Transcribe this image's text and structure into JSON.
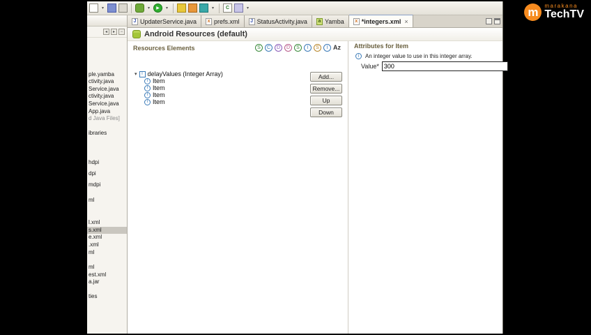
{
  "colors": {
    "brand_orange": "#f68b1f",
    "android_green": "#a4c639",
    "selection_gray": "#c9c6bf",
    "focus_border": "#222222"
  },
  "logo": {
    "m": "m",
    "brand": "marakana",
    "name": "TechTV"
  },
  "toolbar": {
    "icons": [
      {
        "name": "new-file",
        "style": "background:#fefefc;border:1px solid #8a887e"
      },
      {
        "name": "new-dropdown",
        "glyph": "▾"
      },
      {
        "name": "save",
        "style": "background:#7d8fd0;border:1px solid #4a5aa8"
      },
      {
        "name": "print",
        "style": "background:#dcd9d0;border:1px solid #8a887e"
      },
      {
        "name": "debug",
        "style": "background:#6faa3a;border:1px solid #4a7a1a;border-radius:3px"
      },
      {
        "name": "debug-dropdown",
        "glyph": "▾"
      },
      {
        "name": "run",
        "glyph": "▶",
        "style": "background:#2fae2f;color:#fff;border:1px solid #1a7a1a;border-radius:50%;font-size:6px"
      },
      {
        "name": "run-dropdown",
        "glyph": "▾"
      },
      {
        "name": "android-sdk",
        "style": "background:#e8c83a;border:1px solid #a88a1a"
      },
      {
        "name": "ddms",
        "style": "background:#e8973a;border:1px solid #a8651a"
      },
      {
        "name": "emulator",
        "style": "background:#3aa8a8;border:1px solid #1a7878"
      },
      {
        "name": "tools-dropdown",
        "glyph": "▾"
      },
      {
        "name": "new-class",
        "glyph": "C",
        "style": "background:#fff;color:#2a7a2a;border:1px solid #8a887e;font-weight:bold"
      },
      {
        "name": "search",
        "style": "background:#c8c5e8;border:1px solid #7a78a8"
      },
      {
        "name": "search-dropdown",
        "glyph": "▾"
      }
    ]
  },
  "pkg_toolbar": {
    "icons": [
      {
        "glyph": "◂"
      },
      {
        "glyph": "▸"
      },
      {
        "glyph": "−"
      }
    ]
  },
  "tabs": [
    {
      "label": "UpdaterService.java",
      "icon": "J",
      "icon_style": "background:#fff;color:#3a55b0;border:1px solid #9a9a9a"
    },
    {
      "label": "prefs.xml",
      "icon": "x",
      "icon_style": "background:#fff;color:#d07020;border:1px solid #9a9a9a"
    },
    {
      "label": "StatusActivity.java",
      "icon": "J",
      "icon_style": "background:#fff;color:#3a55b0;border:1px solid #9a9a9a"
    },
    {
      "label": "Yamba",
      "icon": "a",
      "icon_style": "background:#cfe07a;color:#3a5a10;border:1px solid #7a9a2a"
    },
    {
      "label": "*integers.xml",
      "icon": "x",
      "icon_style": "background:#fff;color:#d07020;border:1px solid #9a9a9a",
      "close": "×"
    }
  ],
  "package_explorer": {
    "items": [
      {
        "label": "ple.yamba"
      },
      {
        "label": "ctivity.java"
      },
      {
        "label": "Service.java"
      },
      {
        "label": "ctivity.java"
      },
      {
        "label": "Service.java"
      },
      {
        "label": "App.java"
      },
      {
        "label": "d Java Files]"
      },
      {
        "label": "ibraries"
      },
      {
        "label": "hdpi"
      },
      {
        "label": "dpi"
      },
      {
        "label": "mdpi"
      },
      {
        "label": "ml"
      },
      {
        "label": "l.xml"
      },
      {
        "label": "s.xml"
      },
      {
        "label": "e.xml"
      },
      {
        "label": ".xml"
      },
      {
        "label": "ml"
      },
      {
        "label": "ml"
      },
      {
        "label": "est.xml"
      },
      {
        "label": "a.jar"
      },
      {
        "label": "ties"
      }
    ]
  },
  "editor": {
    "title": "Android Resources (default)",
    "resources_label": "Resources Elements",
    "type_icons": [
      {
        "letter": "S",
        "style": "color:#3a8a3a"
      },
      {
        "letter": "C",
        "style": "color:#3a7ab8"
      },
      {
        "letter": "D",
        "style": "color:#8a5ab8"
      },
      {
        "letter": "D",
        "style": "color:#b85a8a"
      },
      {
        "letter": "S",
        "style": "color:#3a8a3a"
      },
      {
        "letter": "I",
        "style": "color:#3a7ab8"
      },
      {
        "letter": "S",
        "style": "color:#b8862a"
      },
      {
        "letter": "I",
        "style": "color:#3a7ab8"
      },
      {
        "letter": "Az",
        "style": "color:#333"
      }
    ],
    "tree": {
      "expander": "▾",
      "root_icon": "I",
      "root_label": "delayValues (Integer Array)",
      "item_icon": "I",
      "items": [
        {
          "label": "Item"
        },
        {
          "label": "Item"
        },
        {
          "label": "Item"
        },
        {
          "label": "Item"
        }
      ]
    },
    "buttons": {
      "add": "Add...",
      "remove": "Remove...",
      "up": "Up",
      "down": "Down"
    },
    "attributes": {
      "title": "Attributes for Item",
      "icon": "I",
      "description": "An integer value to use in this integer array.",
      "value_label": "Value*",
      "value": "300"
    }
  }
}
